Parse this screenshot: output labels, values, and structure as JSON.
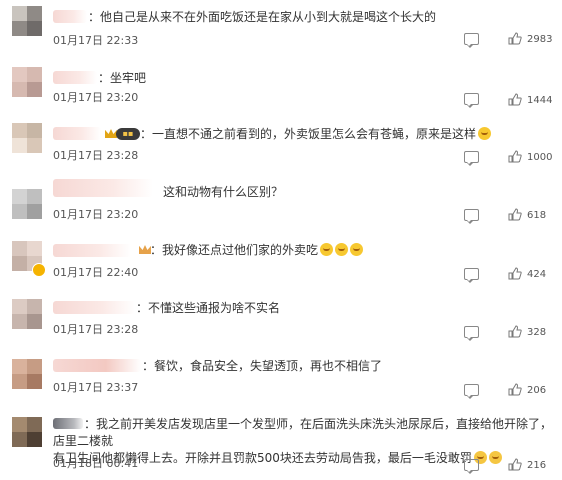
{
  "colors": {
    "text": "#333333",
    "meta": "#555555",
    "icon": "#888888",
    "gold": "#f5b301"
  },
  "comments": [
    {
      "text": "他自己是从来不在外面吃饭还是在家从小到大就是喝这个长大的",
      "time": "01月17日 22:33",
      "likes": "2983"
    },
    {
      "text": "坐牢吧",
      "time": "01月17日 23:20",
      "likes": "1444"
    },
    {
      "text": "一直想不通之前看到的，外卖饭里怎么会有苍蝇，原来是这样",
      "time": "01月17日 23:28",
      "likes": "1000",
      "emoji": "thinking-emoji"
    },
    {
      "text": "这和动物有什么区别？",
      "time": "01月17日 23:20",
      "likes": "618"
    },
    {
      "text": "我好像还点过他们家的外卖吃",
      "time": "01月17日 22:40",
      "likes": "424",
      "emoji": "gasp-emoji"
    },
    {
      "text": "不懂这些通报为啥不实名",
      "time": "01月17日 23:28",
      "likes": "328"
    },
    {
      "text": "餐饮，食品安全，失望透顶，再也不相信了",
      "time": "01月17日 23:37",
      "likes": "206"
    },
    {
      "text_line1": "我之前开美发店发现店里一个发型师，在后面洗头床洗头池尿尿后，直接给他开除了，店里二楼就",
      "text_line2": "有卫生间他都懒得上去。开除并且罚款500块还去劳动局告我，最后一毛没敢罚",
      "time": "01月18日 00:41",
      "likes": "216",
      "emoji": "cry-emoji"
    }
  ]
}
